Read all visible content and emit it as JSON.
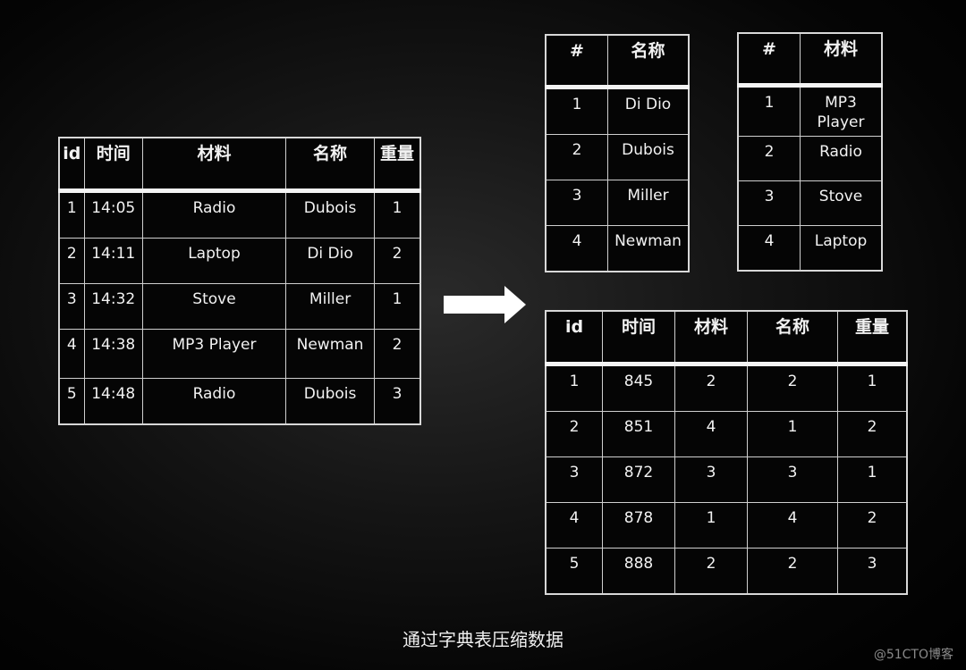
{
  "original_table": {
    "headers": [
      "id",
      "时间",
      "材料",
      "名称",
      "重量"
    ],
    "rows": [
      [
        "1",
        "14:05",
        "Radio",
        "Dubois",
        "1"
      ],
      [
        "2",
        "14:11",
        "Laptop",
        "Di Dio",
        "2"
      ],
      [
        "3",
        "14:32",
        "Stove",
        "Miller",
        "1"
      ],
      [
        "4",
        "14:38",
        "MP3 Player",
        "Newman",
        "2"
      ],
      [
        "5",
        "14:48",
        "Radio",
        "Dubois",
        "3"
      ]
    ]
  },
  "name_dictionary": {
    "headers": [
      "#",
      "名称"
    ],
    "rows": [
      [
        "1",
        "Di Dio"
      ],
      [
        "2",
        "Dubois"
      ],
      [
        "3",
        "Miller"
      ],
      [
        "4",
        "Newman"
      ]
    ]
  },
  "material_dictionary": {
    "headers": [
      "#",
      "材料"
    ],
    "rows": [
      [
        "1",
        "MP3 Player"
      ],
      [
        "2",
        "Radio"
      ],
      [
        "3",
        "Stove"
      ],
      [
        "4",
        "Laptop"
      ]
    ]
  },
  "compressed_table": {
    "headers": [
      "id",
      "时间",
      "材料",
      "名称",
      "重量"
    ],
    "rows": [
      [
        "1",
        "845",
        "2",
        "2",
        "1"
      ],
      [
        "2",
        "851",
        "4",
        "1",
        "2"
      ],
      [
        "3",
        "872",
        "3",
        "3",
        "1"
      ],
      [
        "4",
        "878",
        "1",
        "4",
        "2"
      ],
      [
        "5",
        "888",
        "2",
        "2",
        "3"
      ]
    ]
  },
  "arrow": {
    "icon": "right-arrow-icon",
    "color": "#ffffff"
  },
  "caption": "通过字典表压缩数据",
  "watermark": "@51CTO博客"
}
